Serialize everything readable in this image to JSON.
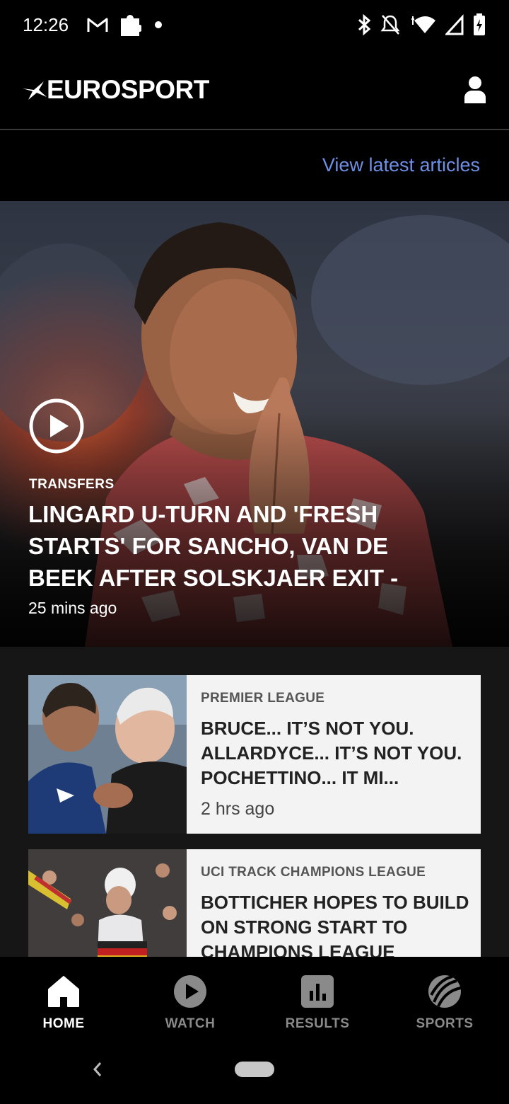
{
  "status_bar": {
    "time": "12:26",
    "icons": [
      "gmail-icon",
      "puzzle-icon",
      "dot-icon",
      "bluetooth-icon",
      "notifications-off-icon",
      "wifi-icon",
      "signal-icon",
      "battery-icon"
    ]
  },
  "header": {
    "logo_text": "EUROSPORT",
    "profile_icon": "user-icon"
  },
  "latest": {
    "link_label": "View latest articles"
  },
  "hero": {
    "category": "TRANSFERS",
    "title": "LINGARD U-TURN AND 'FRESH STARTS' FOR SANCHO, VAN DE BEEK AFTER SOLSKJAER EXIT -",
    "time": "25 mins ago"
  },
  "articles": [
    {
      "category": "PREMIER LEAGUE",
      "title": "BRUCE... IT’S NOT YOU. ALLARDYCE... IT’S NOT YOU. POCHETTINO... IT MI...",
      "time": "2 hrs ago"
    },
    {
      "category": "UCI TRACK CHAMPIONS LEAGUE",
      "title": "BOTTICHER HOPES TO BUILD ON STRONG START TO CHAMPIONS LEAGUE",
      "time": ""
    }
  ],
  "bottom_nav": {
    "items": [
      {
        "label": "HOME",
        "icon": "home-icon",
        "active": true
      },
      {
        "label": "WATCH",
        "icon": "play-icon",
        "active": false
      },
      {
        "label": "RESULTS",
        "icon": "bar-chart-icon",
        "active": false
      },
      {
        "label": "SPORTS",
        "icon": "ball-icon",
        "active": false
      }
    ]
  },
  "colors": {
    "accent_link": "#6f8fe6",
    "background": "#000000",
    "card_background": "#f3f3f3"
  }
}
